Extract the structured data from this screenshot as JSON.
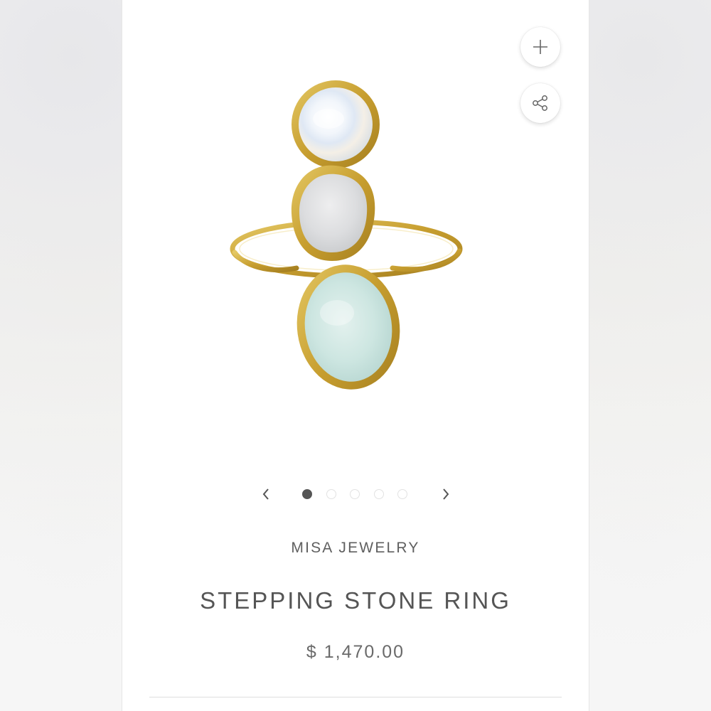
{
  "product": {
    "vendor": "MISA JEWELRY",
    "title": "STEPPING STONE RING",
    "price": "$ 1,470.00"
  },
  "gallery": {
    "image_alt": "Stepping Stone Ring",
    "current_slide": 1,
    "slide_count": 5,
    "actions": {
      "add_icon": "plus-icon",
      "share_icon": "share-icon"
    },
    "nav": {
      "prev_icon": "chevron-left-icon",
      "next_icon": "chevron-right-icon"
    }
  },
  "colors": {
    "text": "#555555",
    "dot_active": "#555555",
    "dot_inactive": "#e2e2e2",
    "gold": "#c9a53a"
  }
}
